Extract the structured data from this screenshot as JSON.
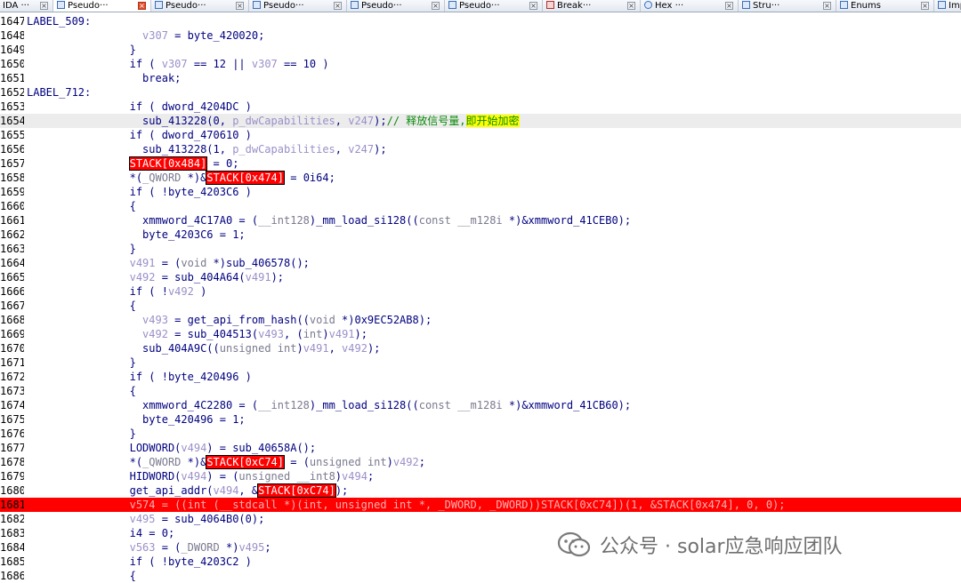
{
  "tabs": [
    {
      "label": "IDA  ···",
      "icon": "ida-icon"
    },
    {
      "label": "Pseudo···",
      "icon": "pseudocode-icon"
    },
    {
      "label": "Pseudo···",
      "icon": "pseudocode-icon"
    },
    {
      "label": "Pseudo···",
      "icon": "pseudocode-icon"
    },
    {
      "label": "Pseudo···",
      "icon": "pseudocode-icon"
    },
    {
      "label": "Pseudo···",
      "icon": "pseudocode-icon"
    },
    {
      "label": "Break···",
      "icon": "breakpoint-icon"
    },
    {
      "label": "Hex  ···",
      "icon": "hex-icon"
    },
    {
      "label": "Stru···",
      "icon": "struct-icon"
    },
    {
      "label": "Enums",
      "icon": "enums-icon"
    },
    {
      "label": "Imp···",
      "icon": "imports-icon"
    }
  ],
  "line_numbers": [
    "1647",
    "1648",
    "1649",
    "1650",
    "1651",
    "1652",
    "1653",
    "1654",
    "1655",
    "1656",
    "1657",
    "1658",
    "1659",
    "1660",
    "1661",
    "1662",
    "1663",
    "1664",
    "1665",
    "1666",
    "1667",
    "1668",
    "1669",
    "1670",
    "1671",
    "1672",
    "1673",
    "1674",
    "1675",
    "1676",
    "1677",
    "1678",
    "1679",
    "1680",
    "1681",
    "1682",
    "1683",
    "1684",
    "1685",
    "1686"
  ],
  "code": {
    "l1647": "LABEL_509:",
    "l1648a": "                  ",
    "l1648v": "v307",
    "l1648b": " = byte_420020;",
    "l1649": "                }",
    "l1650a": "                if ( ",
    "l1650v1": "v307",
    "l1650b": " == 12 || ",
    "l1650v2": "v307",
    "l1650c": " == 10 )",
    "l1651": "                  break;",
    "l1652": "LABEL_712:",
    "l1653": "                if ( dword_4204DC )",
    "l1654a": "                  sub_413228(0, ",
    "l1654v1": "p_dwCapabilities",
    "l1654b": ", ",
    "l1654v2": "v247",
    "l1654c": ");",
    "l1654cm1": "// 释放信号量,",
    "l1654cm2": "即开始加密",
    "l1655": "                if ( dword_470610 )",
    "l1656a": "                  sub_413228(1, ",
    "l1656v1": "p_dwCapabilities",
    "l1656b": ", ",
    "l1656v2": "v247",
    "l1656c": ");",
    "l1657a": "                ",
    "l1657r": "STACK[0x484]",
    "l1657b": " = 0;",
    "l1658a": "                *(",
    "l1658t": "_QWORD",
    "l1658b": " *)&",
    "l1658r": "STACK[0x474]",
    "l1658c": " = 0i64;",
    "l1659": "                if ( !byte_4203C6 )",
    "l1660": "                {",
    "l1661a": "                  xmmword_4C17A0 = (",
    "l1661t1": "__int128",
    "l1661b": ")_mm_load_si128((",
    "l1661t2": "const __m128i",
    "l1661c": " *)&xmmword_41CEB0);",
    "l1662": "                  byte_4203C6 = 1;",
    "l1663": "                }",
    "l1664a": "                ",
    "l1664v": "v491",
    "l1664b": " = (",
    "l1664t": "void",
    "l1664c": " *)sub_406578();",
    "l1665a": "                ",
    "l1665v1": "v492",
    "l1665b": " = sub_404A64(",
    "l1665v2": "v491",
    "l1665c": ");",
    "l1666a": "                if ( !",
    "l1666v": "v492",
    "l1666b": " )",
    "l1667": "                {",
    "l1668a": "                  ",
    "l1668v": "v493",
    "l1668b": " = get_api_from_hash((",
    "l1668t": "void",
    "l1668c": " *)0x9EC52AB8);",
    "l1669a": "                  ",
    "l1669v1": "v492",
    "l1669b": " = sub_404513(",
    "l1669v2": "v493",
    "l1669c": ", (",
    "l1669t": "int",
    "l1669d": ")",
    "l1669v3": "v491",
    "l1669e": ");",
    "l1670a": "                  sub_404A9C((",
    "l1670t": "unsigned int",
    "l1670b": ")",
    "l1670v1": "v491",
    "l1670c": ", ",
    "l1670v2": "v492",
    "l1670d": ");",
    "l1671": "                }",
    "l1672": "                if ( !byte_420496 )",
    "l1673": "                {",
    "l1674a": "                  xmmword_4C2280 = (",
    "l1674t1": "__int128",
    "l1674b": ")_mm_load_si128((",
    "l1674t2": "const __m128i",
    "l1674c": " *)&xmmword_41CB60);",
    "l1675": "                  byte_420496 = 1;",
    "l1676": "                }",
    "l1677a": "                LODWORD(",
    "l1677v": "v494",
    "l1677b": ") = sub_40658A();",
    "l1678a": "                *(",
    "l1678t1": "_QWORD",
    "l1678b": " *)&",
    "l1678r": "STACK[0xC74]",
    "l1678c": " = (",
    "l1678t2": "unsigned int",
    "l1678d": ")",
    "l1678v": "v492",
    "l1678e": ";",
    "l1679a": "                HIDWORD(",
    "l1679v1": "v494",
    "l1679b": ") = (",
    "l1679t": "unsigned __int8",
    "l1679c": ")",
    "l1679v2": "v494",
    "l1679d": ";",
    "l1680a": "                get_api_addr(",
    "l1680v": "v494",
    "l1680b": ", &",
    "l1680r": "STACK[0xC74]",
    "l1680c": ");",
    "l1681": "                v574 = ((int (__stdcall *)(int, unsigned int *, _DWORD, _DWORD))STACK[0xC74])(1, &STACK[0x474], 0, 0);",
    "l1682a": "                ",
    "l1682v": "v495",
    "l1682b": " = sub_4064B0(0);",
    "l1683": "                i4 = 0;",
    "l1684a": "                ",
    "l1684v1": "v563",
    "l1684b": " = (",
    "l1684t": "_DWORD",
    "l1684c": " *)",
    "l1684v2": "v495",
    "l1684d": ";",
    "l1685": "                if ( !byte_4203C2 )",
    "l1686": "                {"
  },
  "watermark": {
    "text": "公众号 · solar应急响应团队",
    "icon": "wechat-logo-icon"
  }
}
